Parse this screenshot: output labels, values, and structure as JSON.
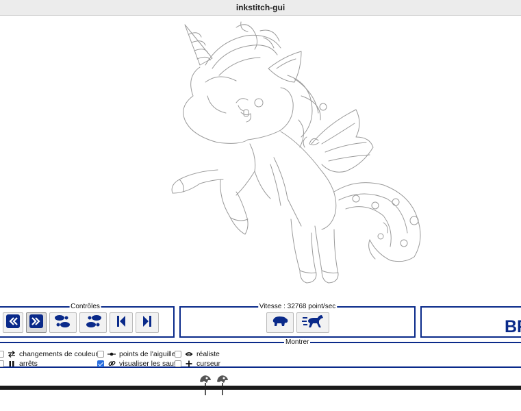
{
  "window": {
    "title": "inkstitch-gui"
  },
  "controls": {
    "legend": "Contrôles",
    "buttons": [
      {
        "name": "previous-command",
        "icon": "double-chevron-left-icon"
      },
      {
        "name": "next-command",
        "icon": "double-chevron-right-icon",
        "active": true
      },
      {
        "name": "step-backward",
        "icon": "footsteps-backward-icon"
      },
      {
        "name": "step-forward",
        "icon": "footsteps-forward-icon"
      },
      {
        "name": "go-to-start",
        "icon": "skip-start-icon"
      },
      {
        "name": "go-to-end",
        "icon": "skip-end-icon"
      }
    ]
  },
  "speed": {
    "legend": "Vitesse : 32768 point/sec",
    "buttons": [
      {
        "name": "slower",
        "icon": "hippo-icon"
      },
      {
        "name": "faster",
        "icon": "running-horse-icon"
      }
    ]
  },
  "right_panel": {
    "text": "BF"
  },
  "show": {
    "legend": "Montrer",
    "options": [
      {
        "label": "changements de couleur",
        "icon": "swap-arrows-icon",
        "checked": false
      },
      {
        "label": "arrêts",
        "icon": "pause-icon",
        "checked": false
      },
      {
        "label": "points de l'aiguille",
        "icon": "needle-points-icon",
        "checked": false
      },
      {
        "label": "visualiser les sauts",
        "icon": "link-icon",
        "checked": true
      },
      {
        "label": "réaliste",
        "icon": "eye-icon",
        "checked": false
      },
      {
        "label": "curseur",
        "icon": "plus-icon",
        "checked": false
      }
    ]
  },
  "timeline": {
    "markers": [
      "stitch-marker-icon",
      "stitch-marker-icon"
    ]
  },
  "colors": {
    "accent": "#0a2a8a",
    "checkbox": "#2a6fe0",
    "drawing_stroke": "#9a9a9a"
  }
}
